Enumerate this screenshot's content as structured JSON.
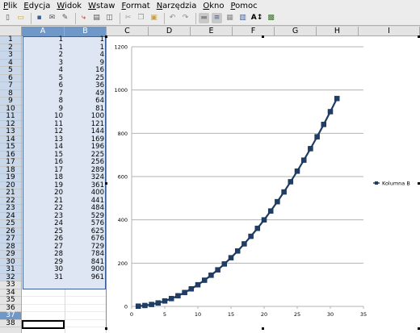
{
  "menu": {
    "items": [
      {
        "key": "P",
        "rest": "lik"
      },
      {
        "key": "E",
        "rest": "dycja"
      },
      {
        "key": "W",
        "rest": "idok"
      },
      {
        "key": "W",
        "rest": "staw"
      },
      {
        "key": "F",
        "rest": "ormat"
      },
      {
        "key": "N",
        "rest": "arzędzia"
      },
      {
        "key": "O",
        "rest": "kno"
      },
      {
        "key": "P",
        "rest": "omoc"
      }
    ]
  },
  "toolbar": {
    "icons": [
      "new-document-icon",
      "open-icon",
      "save-icon",
      "email-icon",
      "edit-file-icon",
      "pdf-icon",
      "print-icon",
      "print-preview-icon",
      "cut-icon",
      "copy-icon",
      "paste-icon",
      "undo-icon",
      "redo-icon",
      "chart-title-icon",
      "legend-icon",
      "chart-area-icon",
      "chart-grid-icon",
      "scale-text-icon",
      "data-table-icon"
    ],
    "scale_text_label": "A↕",
    "colors": {
      "accent": "#3b5f9a",
      "pdf": "#cc0000"
    }
  },
  "sheet": {
    "columns": [
      "A",
      "B",
      "C",
      "D",
      "E",
      "F",
      "G",
      "H",
      "I"
    ],
    "selected_columns": [
      "A",
      "B"
    ],
    "rows": [
      "1",
      "2",
      "3",
      "4",
      "5",
      "6",
      "7",
      "8",
      "9",
      "10",
      "11",
      "12",
      "13",
      "14",
      "15",
      "16",
      "17",
      "18",
      "19",
      "20",
      "21",
      "22",
      "23",
      "24",
      "25",
      "26",
      "27",
      "28",
      "29",
      "30",
      "31",
      "32",
      "33",
      "34",
      "35",
      "36",
      "37",
      "38"
    ],
    "current_row": "37",
    "col_a": [
      "1",
      "1",
      "2",
      "3",
      "4",
      "5",
      "6",
      "7",
      "8",
      "9",
      "10",
      "11",
      "12",
      "13",
      "14",
      "15",
      "16",
      "17",
      "18",
      "19",
      "20",
      "21",
      "22",
      "23",
      "24",
      "25",
      "26",
      "27",
      "28",
      "29",
      "30",
      "31"
    ],
    "col_b": [
      "1",
      "1",
      "4",
      "9",
      "16",
      "25",
      "36",
      "49",
      "64",
      "81",
      "100",
      "121",
      "144",
      "169",
      "196",
      "225",
      "256",
      "289",
      "324",
      "361",
      "400",
      "441",
      "484",
      "529",
      "576",
      "625",
      "676",
      "729",
      "784",
      "841",
      "900",
      "961"
    ]
  },
  "chart_data": {
    "type": "line",
    "title": "",
    "xlabel": "",
    "ylabel": "",
    "xlim": [
      0,
      35
    ],
    "ylim": [
      0,
      1200
    ],
    "xticks": [
      "0",
      "5",
      "10",
      "15",
      "20",
      "25",
      "30",
      "35"
    ],
    "yticks": [
      "0",
      "200",
      "400",
      "600",
      "800",
      "1000",
      "1200"
    ],
    "grid": true,
    "legend_position": "right",
    "series": [
      {
        "name": "Kolumna B",
        "color": "#1f3d66",
        "marker": "square",
        "x": [
          1,
          1,
          2,
          3,
          4,
          5,
          6,
          7,
          8,
          9,
          10,
          11,
          12,
          13,
          14,
          15,
          16,
          17,
          18,
          19,
          20,
          21,
          22,
          23,
          24,
          25,
          26,
          27,
          28,
          29,
          30,
          31
        ],
        "y": [
          1,
          1,
          4,
          9,
          16,
          25,
          36,
          49,
          64,
          81,
          100,
          121,
          144,
          169,
          196,
          225,
          256,
          289,
          324,
          361,
          400,
          441,
          484,
          529,
          576,
          625,
          676,
          729,
          784,
          841,
          900,
          961
        ]
      }
    ]
  }
}
